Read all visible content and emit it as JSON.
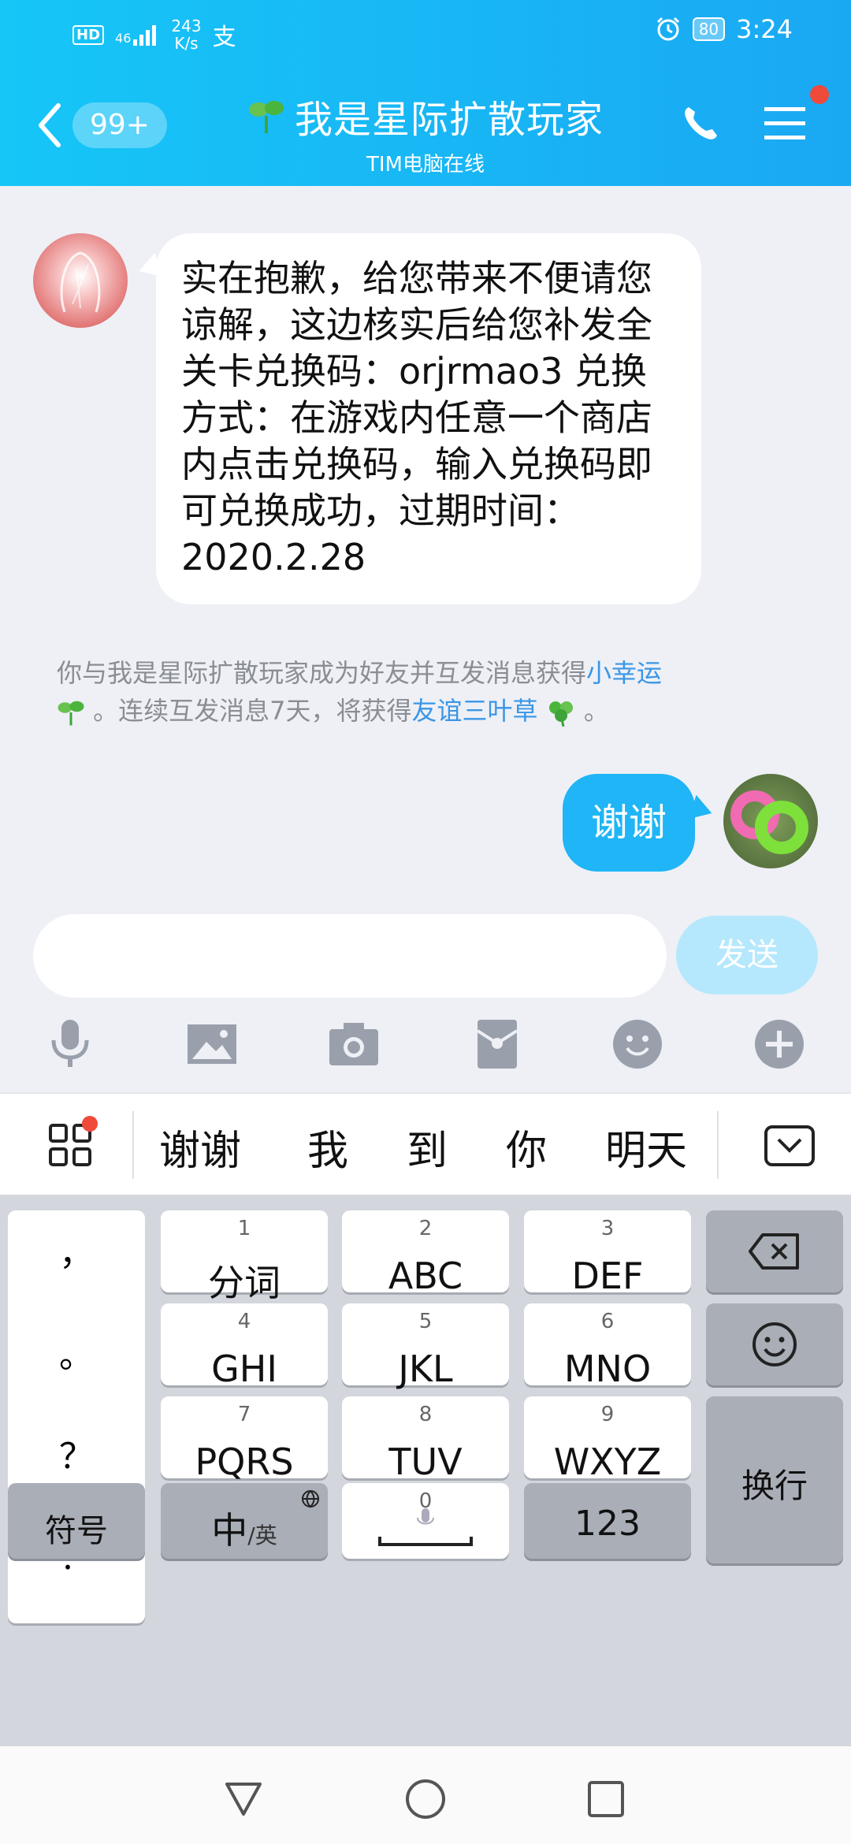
{
  "status_bar": {
    "hd": "HD",
    "signal": "46",
    "net_speed_value": "243",
    "net_speed_unit": "K/s",
    "wechat_like": "支",
    "battery": "80",
    "time": "3:24"
  },
  "header": {
    "unread": "99+",
    "title": "我是星际扩散玩家",
    "subtitle": "TIM电脑在线"
  },
  "messages": {
    "incoming": "实在抱歉，给您带来不便请您谅解，这边核实后给您补发全关卡兑换码：orjrmao3 兑换方式：在游戏内任意一个商店内点击兑换码，输入兑换码即可兑换成功，过期时间：2020.2.28",
    "outgoing": "谢谢"
  },
  "system_message": {
    "part1": "你与我是星际扩散玩家成为好友并互发消息获得",
    "link1": "小幸运",
    "part2": "。连续互发消息7天，将获得",
    "link2": "友谊三叶草",
    "part3": "。"
  },
  "input": {
    "placeholder": "",
    "send_label": "发送"
  },
  "candidates": [
    "谢谢",
    "我",
    "到",
    "你",
    "明天"
  ],
  "keyboard": {
    "punct": [
      "，",
      "。",
      "？",
      "！"
    ],
    "keys": [
      {
        "num": "1",
        "label": "分词"
      },
      {
        "num": "2",
        "label": "ABC"
      },
      {
        "num": "3",
        "label": "DEF"
      },
      {
        "num": "4",
        "label": "GHI"
      },
      {
        "num": "5",
        "label": "JKL"
      },
      {
        "num": "6",
        "label": "MNO"
      },
      {
        "num": "7",
        "label": "PQRS"
      },
      {
        "num": "8",
        "label": "TUV"
      },
      {
        "num": "9",
        "label": "WXYZ"
      }
    ],
    "symbols": "符号",
    "lang_main": "中",
    "lang_alt": "/英",
    "space_num": "0",
    "num_key": "123",
    "enter": "换行"
  },
  "colors": {
    "header_start": "#16c6f7",
    "header_end": "#1aa8f3",
    "outgoing_bubble": "#1fb5f6",
    "link": "#3a96e6",
    "badge": "#f04a3b"
  }
}
